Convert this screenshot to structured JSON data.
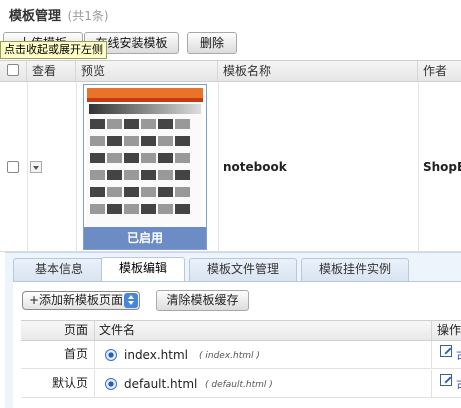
{
  "header": {
    "title": "模板管理",
    "count": "(共1条)"
  },
  "toolbar": {
    "upload_label": "上传模板",
    "online_install_label": "在线安装模板",
    "delete_label": "删除"
  },
  "tooltip": {
    "text": "点击收起或展开左侧"
  },
  "grid": {
    "columns": [
      "查看",
      "预览",
      "模板名称",
      "作者"
    ],
    "rows": [
      {
        "status": "已启用",
        "name": "notebook",
        "author": "ShopEx"
      }
    ]
  },
  "detail": {
    "tabs": [
      "基本信息",
      "模板编辑",
      "模板文件管理",
      "模板挂件实例"
    ],
    "active_tab": "模板编辑",
    "add_page_select": "+添加新模板页面",
    "clear_cache_label": "清除模板缓存",
    "file_table": {
      "headers": [
        "页面",
        "文件名",
        "操作"
      ],
      "rows": [
        {
          "page": "首页",
          "file": "index.html",
          "hint": "( index.html )",
          "op": "可"
        },
        {
          "page": "默认页",
          "file": "default.html",
          "hint": "( default.html )",
          "op": "可"
        }
      ]
    }
  },
  "colors": {
    "accent": "#6b8cc5",
    "tab_bg": "#eef4fc",
    "link": "#2a62c9"
  }
}
